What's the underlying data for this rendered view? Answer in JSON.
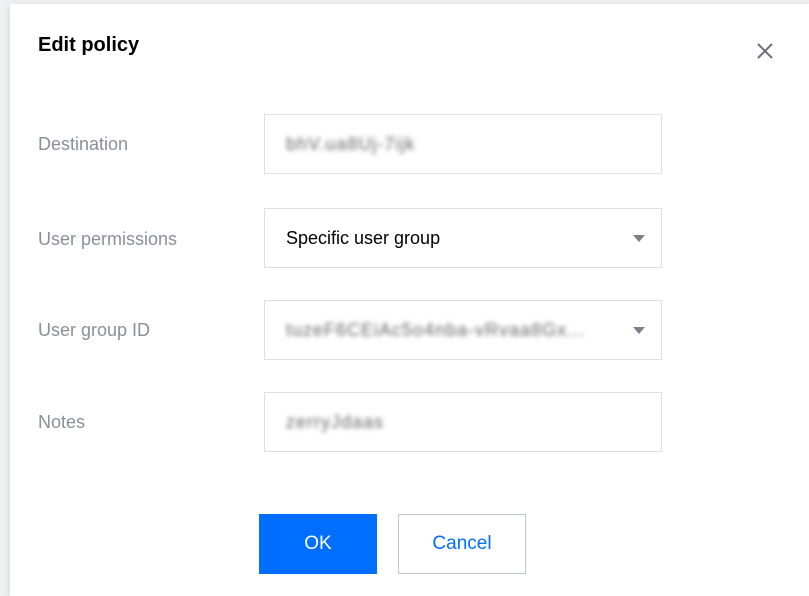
{
  "dialog": {
    "title": "Edit policy",
    "close_icon": "close-icon"
  },
  "form": {
    "destination": {
      "label": "Destination",
      "value": "bhV.ua8Uj-7ijk"
    },
    "user_permissions": {
      "label": "User permissions",
      "value": "Specific user group"
    },
    "user_group_id": {
      "label": "User group ID",
      "value": "tuzeF6CEiAc5o4nba-vRvaa8Gx..."
    },
    "notes": {
      "label": "Notes",
      "value": "zerryJdaas"
    }
  },
  "buttons": {
    "ok": "OK",
    "cancel": "Cancel"
  },
  "colors": {
    "primary": "#006eff",
    "label": "#8a8f99",
    "border": "#dcdfe6"
  }
}
